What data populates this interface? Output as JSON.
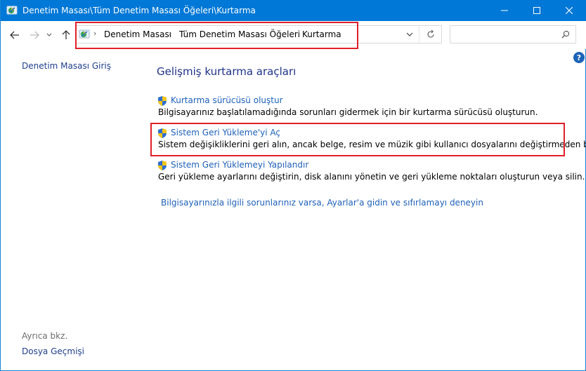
{
  "window": {
    "title": "Denetim Masası\\Tüm Denetim Masası Öğeleri\\Kurtarma"
  },
  "address_bar": {
    "breadcrumbs": [
      "Denetim Masası",
      "Tüm Denetim Masası Öğeleri",
      "Kurtarma"
    ]
  },
  "search": {
    "placeholder": ""
  },
  "help": {
    "label": "?"
  },
  "left_pane": {
    "home_link": "Denetim Masası Giriş",
    "see_also_label": "Ayrıca bkz.",
    "see_also_link": "Dosya Geçmişi"
  },
  "main": {
    "title": "Gelişmiş kurtarma araçları",
    "tasks": [
      {
        "link": "Kurtarma sürücüsü oluştur",
        "description": "Bilgisayarınız başlatılamadığında sorunları gidermek için bir kurtarma sürücüsü oluşturun."
      },
      {
        "link": "Sistem Geri Yükleme'yi Aç",
        "description": "Sistem değişikliklerini geri alın, ancak belge, resim ve müzik gibi kullanıcı dosyalarını değiştirmeden bırakın."
      },
      {
        "link": "Sistem Geri Yüklemeyi Yapılandır",
        "description": "Geri yükleme ayarlarını değiştirin, disk alanını yönetin ve geri yükleme noktaları oluşturun veya silin."
      }
    ],
    "bottom_link": "Bilgisayarınızla ilgili sorunlarınız varsa, Ayarlar'a gidin ve sıfırlamayı deneyin"
  },
  "colors": {
    "titlebar": "#0078d7",
    "link": "#1e60b8",
    "heading": "#1e3287",
    "annotation_box": "#e0202a"
  },
  "icons": {
    "app": "control-panel-icon",
    "shield": "uac-shield-icon",
    "back": "arrow-left-icon",
    "forward": "arrow-right-icon",
    "up": "arrow-up-icon",
    "refresh": "refresh-icon",
    "search": "search-icon"
  }
}
